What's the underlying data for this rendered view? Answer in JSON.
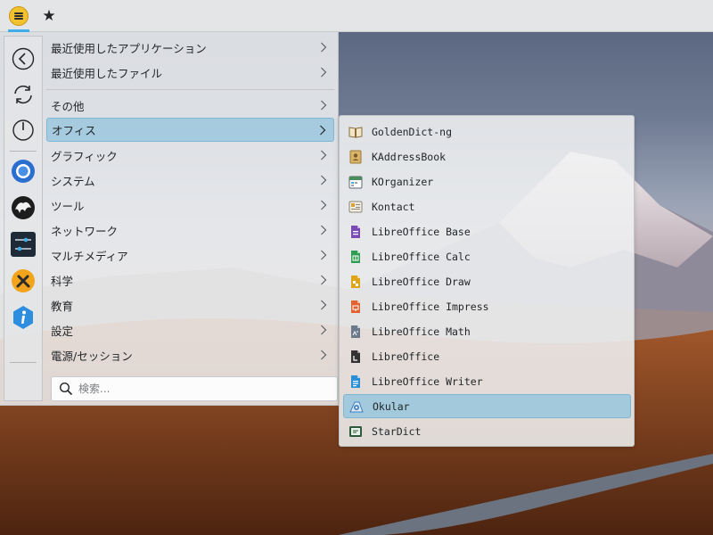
{
  "panel": {
    "launcher_icon": "menu-icon",
    "favorites_icon": "star-icon",
    "favorites_glyph": "★"
  },
  "sidebar": {
    "buttons": [
      {
        "name": "back",
        "icon": "back-arrow-icon"
      },
      {
        "name": "refresh",
        "icon": "refresh-icon"
      },
      {
        "name": "power",
        "icon": "power-icon"
      },
      {
        "name": "chromium",
        "icon": "chromium-icon"
      },
      {
        "name": "cave-app",
        "icon": "cave-icon"
      },
      {
        "name": "control-center",
        "icon": "sliders-icon"
      },
      {
        "name": "tools",
        "icon": "tools-icon"
      },
      {
        "name": "info",
        "icon": "info-icon"
      }
    ]
  },
  "categories": [
    {
      "label": "最近使用したアプリケーション"
    },
    {
      "label": "最近使用したファイル"
    },
    {
      "label": "その他"
    },
    {
      "label": "オフィス"
    },
    {
      "label": "グラフィック"
    },
    {
      "label": "システム"
    },
    {
      "label": "ツール"
    },
    {
      "label": "ネットワーク"
    },
    {
      "label": "マルチメディア"
    },
    {
      "label": "科学"
    },
    {
      "label": "教育"
    },
    {
      "label": "設定"
    },
    {
      "label": "電源/セッション"
    }
  ],
  "selected_category": "オフィス",
  "search": {
    "placeholder": "検索...",
    "value": ""
  },
  "apps": [
    {
      "label": "GoldenDict-ng",
      "icon": "goldendict-icon",
      "color": "#8a6d3b"
    },
    {
      "label": "KAddressBook",
      "icon": "addressbook-icon",
      "color": "#c9a24a"
    },
    {
      "label": "KOrganizer",
      "icon": "organizer-icon",
      "color": "#4a8c5c"
    },
    {
      "label": "Kontact",
      "icon": "kontact-icon",
      "color": "#d8a23a"
    },
    {
      "label": "LibreOffice Base",
      "icon": "libreoffice-base-icon",
      "color": "#7b4ab3"
    },
    {
      "label": "LibreOffice Calc",
      "icon": "libreoffice-calc-icon",
      "color": "#2f9e52"
    },
    {
      "label": "LibreOffice Draw",
      "icon": "libreoffice-draw-icon",
      "color": "#e0a417"
    },
    {
      "label": "LibreOffice Impress",
      "icon": "libreoffice-impress-icon",
      "color": "#e0622e"
    },
    {
      "label": "LibreOffice Math",
      "icon": "libreoffice-math-icon",
      "color": "#6b7b8c"
    },
    {
      "label": "LibreOffice",
      "icon": "libreoffice-icon",
      "color": "#333333"
    },
    {
      "label": "LibreOffice Writer",
      "icon": "libreoffice-writer-icon",
      "color": "#2b8fd6"
    },
    {
      "label": "Okular",
      "icon": "okular-icon",
      "color": "#3a7fc4"
    },
    {
      "label": "StarDict",
      "icon": "stardict-icon",
      "color": "#2d5a3c"
    }
  ],
  "selected_app": "Okular"
}
